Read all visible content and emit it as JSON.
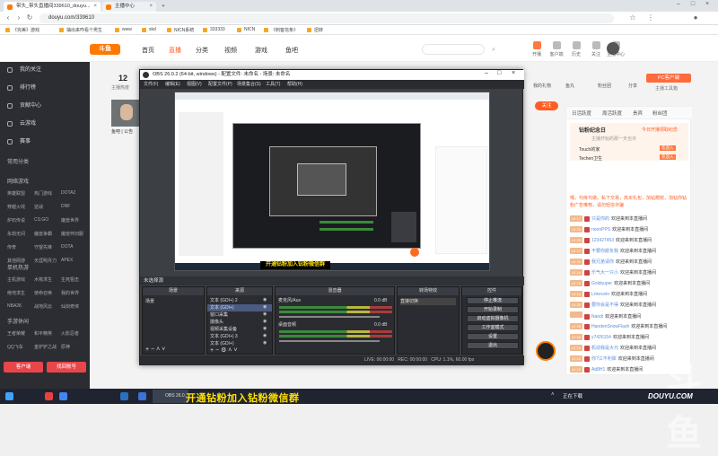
{
  "browser": {
    "tabs": [
      {
        "label": "带头_带头直播间339610_douyu..."
      },
      {
        "label": "主播中心"
      }
    ],
    "url": "douyu.com/339610",
    "bookmarks": [
      "《完美》游戏",
      "抽出来咋看个男生",
      "www",
      "skd",
      "NICN系统",
      "333333",
      "NICN",
      "《刺客信条》",
      "扭转"
    ]
  },
  "douyu": {
    "logo": "斗鱼",
    "nav": [
      "首页",
      "直播",
      "分类",
      "视频",
      "游戏",
      "鱼吧"
    ],
    "nav_active": 1,
    "header_icons": [
      "开播",
      "客户端",
      "历史",
      "关注",
      "主播中心"
    ],
    "room_count": "12",
    "room_label": "主播热度",
    "streamer": "鱼吧 | 公告",
    "pc_btn": "PC客户端",
    "pc_sub": "主播工具箱",
    "stats": [
      "我的礼物",
      "鱼丸",
      "粉丝团",
      "分享"
    ],
    "follow_btn": "关注"
  },
  "sidebar": {
    "top_items": [
      "我的关注",
      "排行榜",
      "贡献中心",
      "云游戏",
      "赛事"
    ],
    "section1": "常用分类",
    "section2": "网络游戏",
    "games": [
      [
        "英雄联盟",
        "热门游戏",
        "DOTA2"
      ],
      [
        "穿越火线",
        "逆战",
        "DNF"
      ],
      [
        "炉石传说",
        "CS:GO",
        "魔兽世界"
      ],
      [
        "永劫无间",
        "魔兽争霸",
        "魔兽怀旧服"
      ],
      [
        "传奇",
        "守望先锋",
        "DOTA"
      ],
      [
        "其他网游",
        "天涯明月刀",
        "APEX"
      ]
    ],
    "section3": "单机热游",
    "single": [
      [
        "主机游戏",
        "木筏求生",
        "生死狙击"
      ],
      [
        "绝地求生",
        "使命召唤",
        "我的世界"
      ],
      [
        "NBA2K",
        "战地风云",
        "仙剑奇侠"
      ]
    ],
    "section4": "手游休闲",
    "mobile": [
      [
        "王者荣耀",
        "和平精英",
        "火影忍者"
      ],
      [
        "QQ飞车",
        "金铲铲之战",
        "原神"
      ]
    ],
    "bottom_buttons": [
      "客户端",
      "找回账号"
    ]
  },
  "right_panel": {
    "tabs": [
      "日活跃度",
      "周活跃度",
      "贵宾",
      "粉丝团",
      "主播"
    ],
    "notice_title": "钻粉纪念日",
    "notice_link": "今日开播领取纪念",
    "notice_sub": "主播开始的那一天也许",
    "rank": [
      {
        "name": "Touch的家",
        "tag": "欢迎入"
      },
      {
        "name": "Techen卫生",
        "tag": "欢迎入"
      }
    ],
    "promo": "喂，代练代做，私下交易，高买礼包，加钻赠收，加钻你钻粉广告推荐，请勿轻信诈骗",
    "chat": [
      {
        "lv": "LV 17",
        "nick": "只是你的",
        "msg": "欢迎来到本直播间"
      },
      {
        "lv": "LV 28",
        "nick": "noonPPS",
        "msg": "欢迎来到本直播间"
      },
      {
        "lv": "LV 23",
        "nick": "123427453",
        "msg": "欢迎来到本直播间"
      },
      {
        "lv": "LV 17",
        "nick": "不要你欺负我",
        "msg": "欢迎来到本直播间"
      },
      {
        "lv": "LV 21",
        "nick": "我兄弟请你",
        "msg": "欢迎来到本直播间"
      },
      {
        "lv": "LV 14",
        "nick": "乐气大一只小",
        "msg": "欢迎来到本直播间"
      },
      {
        "lv": "LV 15",
        "nick": "Goldsuper",
        "msg": "欢迎来到本直播间"
      },
      {
        "lv": "LV 14",
        "nick": "Lnkecelo",
        "msg": "欢迎来到本直播间"
      },
      {
        "lv": "LV 29",
        "nick": "要你会是不得",
        "msg": "欢迎来到本直播间"
      },
      {
        "lv": "",
        "nick": "Nandi",
        "msg": "欢迎来到本直播间"
      },
      {
        "lv": "LV 29",
        "nick": "HandenSnowFlash",
        "msg": "欢迎来到本直播间"
      },
      {
        "lv": "LV 20",
        "nick": "y7426154",
        "msg": "欢迎来到本直播间"
      },
      {
        "lv": "LV 10",
        "nick": "机动我是大元",
        "msg": "欢迎来到本直播间"
      },
      {
        "lv": "LV 10",
        "nick": "你?江不利岸",
        "msg": "欢迎来到本直播间"
      },
      {
        "lv": "LV 10",
        "nick": "Ad8H1",
        "msg": "欢迎来到本直播间"
      }
    ]
  },
  "obs": {
    "title": "OBS 26.0.2 (64-bit, windows) - 配置文件: 未命名 - 场景: 未命名",
    "menu": [
      "文件(F)",
      "编辑(E)",
      "视图(V)",
      "配置文件(P)",
      "场景集合(S)",
      "工具(T)",
      "帮助(H)"
    ],
    "scene_label": "未选择源",
    "panels": {
      "scenes": {
        "title": "场景",
        "items": [
          "场景"
        ]
      },
      "sources": {
        "title": "来源",
        "items": [
          "文本 (GDI+) 2",
          "文本 (GDI+)",
          "窗口采集",
          "摄像头",
          "视频采集设备",
          "文本 (GDI+) 3",
          "文本 (GDI+)"
        ]
      },
      "mixer": {
        "title": "混音器",
        "tracks": [
          {
            "name": "麦克风/Aux",
            "db": "0.0 dB"
          },
          {
            "name": "桌面音频",
            "db": "0.0 dB"
          }
        ]
      },
      "transitions": {
        "title": "转场特效",
        "value": "直接切换"
      },
      "controls": {
        "title": "控件",
        "buttons": [
          "停止推流",
          "开始录制",
          "启动虚拟摄像机",
          "工作室模式",
          "设置",
          "退出"
        ]
      }
    },
    "status": {
      "live": "LIVE: 00:00:00",
      "rec": "REC: 00:00:00",
      "cpu": "CPU: 1.1%, 60.00 fps"
    },
    "preview_banner": "开通钻粉加入钻粉微信群"
  },
  "taskbar": {
    "obs_label": "OBS 26.0...",
    "banner": "开通钻粉加入钻粉微信群",
    "clock": "正在下载",
    "watermark": "DOUYU.COM"
  },
  "colors": {
    "brand": "#ff7800",
    "obs_bg": "#3c3f44",
    "taskbar": "#1f2430",
    "banner": "#ffe000"
  }
}
